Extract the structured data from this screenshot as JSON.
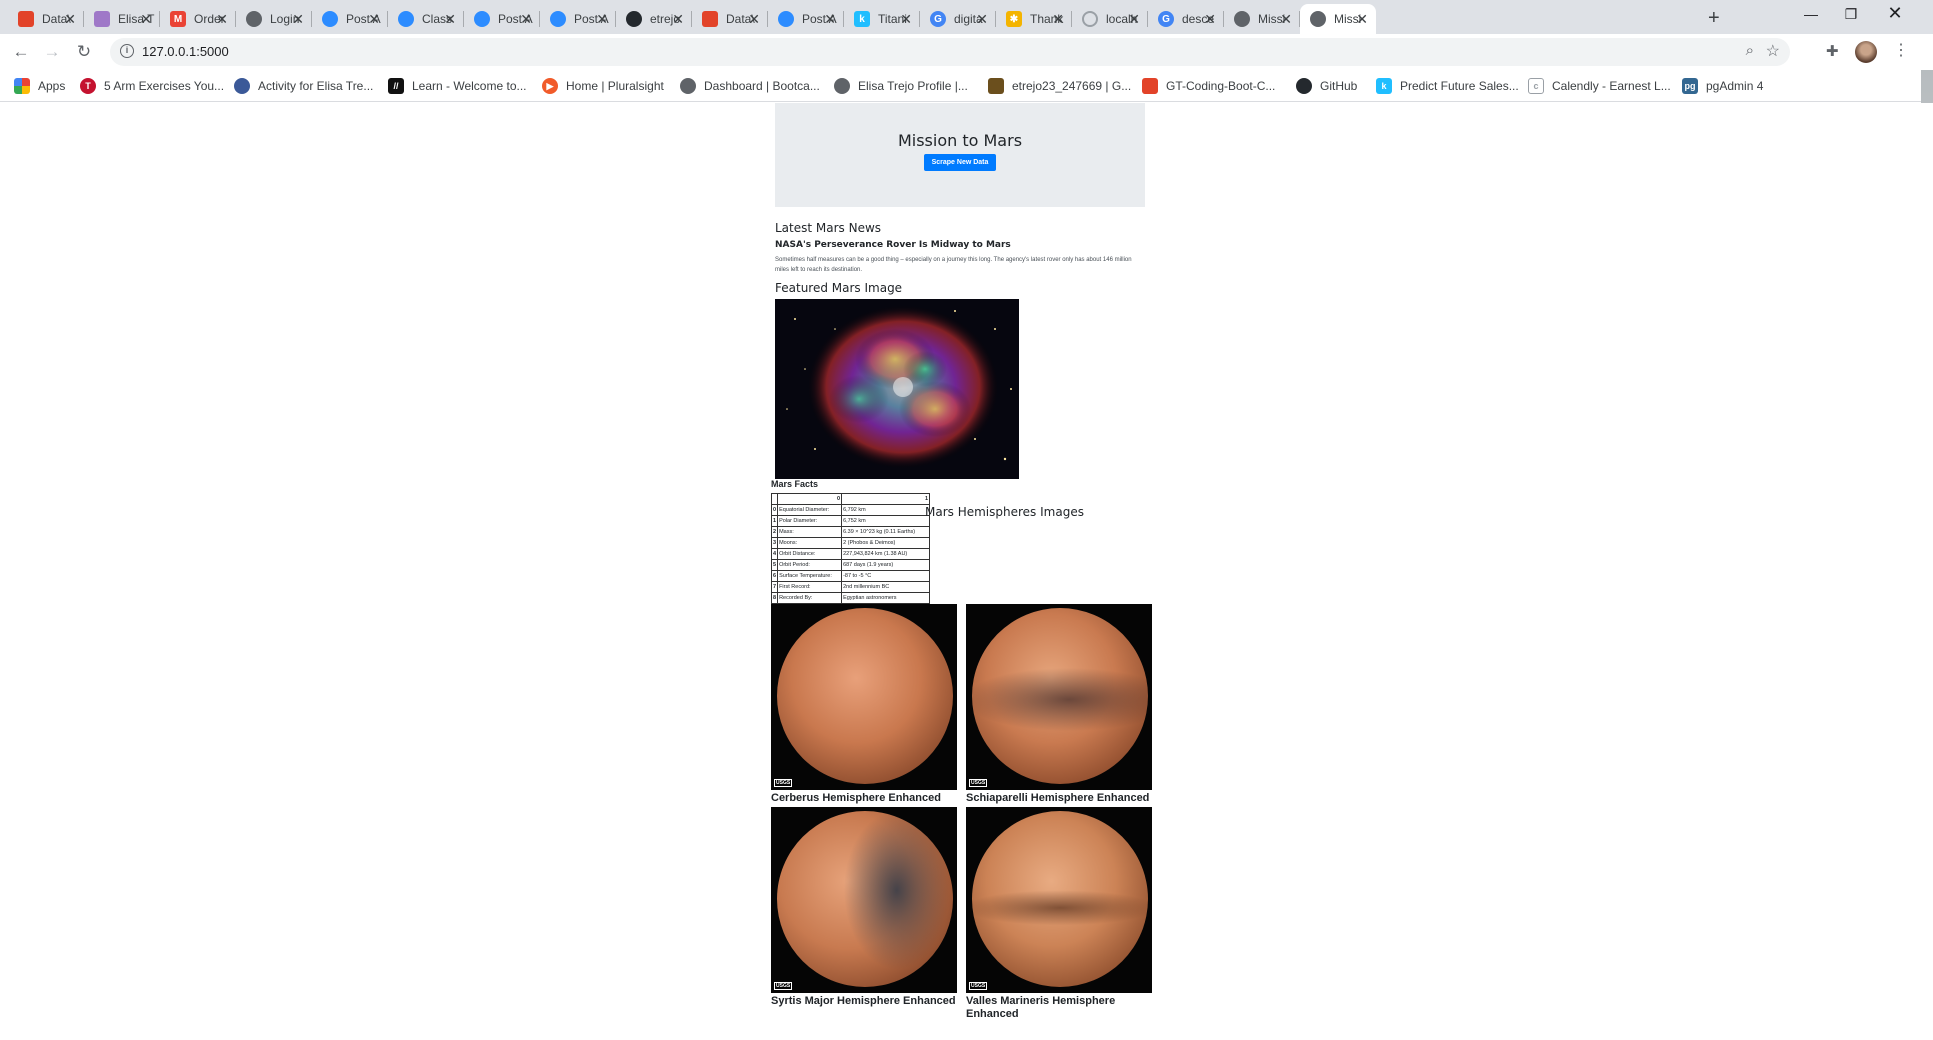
{
  "browser": {
    "tabs": [
      {
        "title": "Data\\",
        "icon": "gitlab-icon",
        "color": "#e24329"
      },
      {
        "title": "Elisa T",
        "icon": "slack-icon",
        "color": "#9f78c8"
      },
      {
        "title": "Order",
        "icon": "gmail-icon",
        "color": "#ea4335"
      },
      {
        "title": "Login",
        "icon": "globe-icon",
        "color": "#5f6368"
      },
      {
        "title": "Post A",
        "icon": "zoom-icon",
        "color": "#2d8cff"
      },
      {
        "title": "Class",
        "icon": "zoom-icon",
        "color": "#2d8cff"
      },
      {
        "title": "Post A",
        "icon": "zoom-icon",
        "color": "#2d8cff"
      },
      {
        "title": "Post A",
        "icon": "zoom-icon",
        "color": "#2d8cff"
      },
      {
        "title": "etrejo",
        "icon": "github-icon",
        "color": "#24292e"
      },
      {
        "title": "Data\\",
        "icon": "gitlab-icon",
        "color": "#e24329"
      },
      {
        "title": "Post A",
        "icon": "zoom-icon",
        "color": "#2d8cff"
      },
      {
        "title": "Titani",
        "icon": "kaggle-icon",
        "color": "#20beff"
      },
      {
        "title": "digita",
        "icon": "google-icon",
        "color": "#4285f4"
      },
      {
        "title": "Thank",
        "icon": "sparkle-icon",
        "color": "#f4b400"
      },
      {
        "title": "localh",
        "icon": "loading-icon",
        "color": "#9aa0a6"
      },
      {
        "title": "desce",
        "icon": "google-icon",
        "color": "#4285f4"
      },
      {
        "title": "Missi",
        "icon": "globe-icon",
        "color": "#5f6368"
      },
      {
        "title": "Missi",
        "icon": "globe-icon",
        "color": "#5f6368",
        "active": true
      }
    ],
    "url": "127.0.0.1:5000",
    "bookmarks": [
      {
        "label": "Apps",
        "icon": "apps-grid-icon",
        "color": "#ea4335"
      },
      {
        "label": "5 Arm Exercises You...",
        "icon": "bookmark-icon",
        "color": "#c4122f"
      },
      {
        "label": "Activity for Elisa Tre...",
        "icon": "person-icon",
        "color": "#3b5998"
      },
      {
        "label": "Learn - Welcome to...",
        "icon": "slash-icon",
        "color": "#111111"
      },
      {
        "label": "Home | Pluralsight",
        "icon": "pluralsight-icon",
        "color": "#f15b2a"
      },
      {
        "label": "Dashboard | Bootca...",
        "icon": "globe-icon",
        "color": "#5f6368"
      },
      {
        "label": "Elisa Trejo Profile |...",
        "icon": "globe-icon",
        "color": "#5f6368"
      },
      {
        "label": "etrejo23_247669 | G...",
        "icon": "gitlab-icon",
        "color": "#6b4f1d"
      },
      {
        "label": "GT-Coding-Boot-C...",
        "icon": "gitlab-icon",
        "color": "#e24329"
      },
      {
        "label": "GitHub",
        "icon": "github-icon",
        "color": "#24292e"
      },
      {
        "label": "Predict Future Sales...",
        "icon": "kaggle-icon",
        "color": "#20beff"
      },
      {
        "label": "Calendly - Earnest L...",
        "icon": "calendly-icon",
        "color": "#9aa0a6"
      },
      {
        "label": "pgAdmin 4",
        "icon": "pgadmin-icon",
        "color": "#336791"
      }
    ]
  },
  "page": {
    "heading": "Mission to Mars",
    "scrape_button": "Scrape New Data",
    "news_section": "Latest Mars News",
    "news_title": "NASA's Perseverance Rover Is Midway to Mars",
    "news_paragraph": "Sometimes half measures can be a good thing – especially on a journey this long. The agency's latest rover only has about 146 million miles left to reach its destination.",
    "featured_section": "Featured Mars Image",
    "facts_label": "Mars Facts",
    "facts_headers": [
      "",
      "0",
      "1"
    ],
    "facts": [
      {
        "idx": "0",
        "key": "Equatorial Diameter:",
        "val": "6,792 km"
      },
      {
        "idx": "1",
        "key": "Polar Diameter:",
        "val": "6,752 km"
      },
      {
        "idx": "2",
        "key": "Mass:",
        "val": "6.39 × 10^23 kg (0.11 Earths)"
      },
      {
        "idx": "3",
        "key": "Moons:",
        "val": "2 (Phobos & Deimos)"
      },
      {
        "idx": "4",
        "key": "Orbit Distance:",
        "val": "227,943,824 km (1.38 AU)"
      },
      {
        "idx": "5",
        "key": "Orbit Period:",
        "val": "687 days (1.9 years)"
      },
      {
        "idx": "6",
        "key": "Surface Temperature:",
        "val": "-87 to -5 °C"
      },
      {
        "idx": "7",
        "key": "First Record:",
        "val": "2nd millennium BC"
      },
      {
        "idx": "8",
        "key": "Recorded By:",
        "val": "Egyptian astronomers"
      }
    ],
    "hemispheres_section": "Mars Hemispheres Images",
    "hemispheres": [
      {
        "title": "Cerberus Hemisphere Enhanced",
        "badge": "USGS"
      },
      {
        "title": "Schiaparelli Hemisphere Enhanced",
        "badge": "USGS"
      },
      {
        "title": "Syrtis Major Hemisphere Enhanced",
        "badge": "USGS"
      },
      {
        "title": "Valles Marineris Hemisphere Enhanced",
        "badge": "USGS"
      }
    ]
  }
}
